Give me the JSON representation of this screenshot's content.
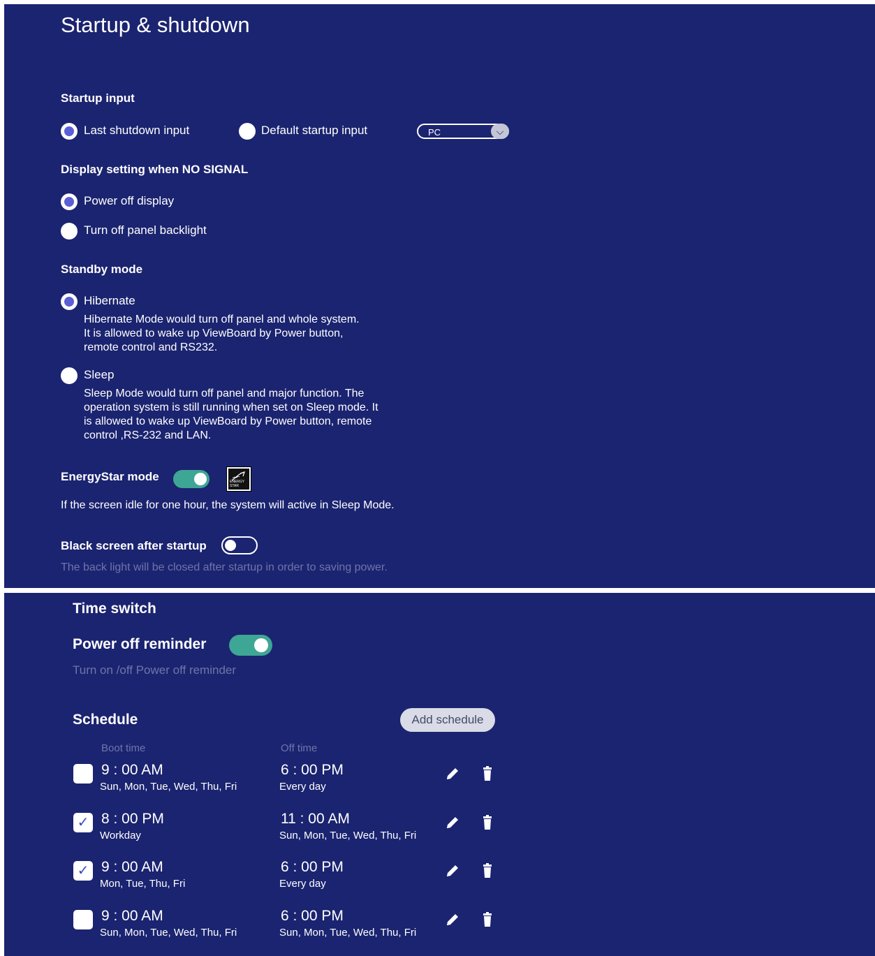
{
  "startup": {
    "title": "Startup & shutdown",
    "startup_input": {
      "heading": "Startup input",
      "options": [
        {
          "label": "Last shutdown input",
          "selected": true
        },
        {
          "label": "Default startup input",
          "selected": false
        }
      ],
      "dropdown_value": "PC"
    },
    "no_signal": {
      "heading": "Display setting when NO SIGNAL",
      "options": [
        {
          "label": "Power off display",
          "selected": true
        },
        {
          "label": "Turn off panel backlight",
          "selected": false
        }
      ]
    },
    "standby": {
      "heading": "Standby mode",
      "options": [
        {
          "label": "Hibernate",
          "selected": true,
          "description": "Hibernate Mode would turn off panel and whole system.\nIt is allowed to wake up ViewBoard by Power button,\nremote control and RS232."
        },
        {
          "label": "Sleep",
          "selected": false,
          "description": "Sleep Mode would turn off panel and major function. The\noperation system is still running when set on Sleep mode. It\nis allowed to wake up ViewBoard by Power button, remote\ncontrol ,RS-232 and LAN."
        }
      ]
    },
    "energystar": {
      "label": "EnergyStar mode",
      "enabled": true,
      "logo_text": "ENERGY STAR",
      "description": "If the screen idle for one hour, the system will active in Sleep Mode."
    },
    "black_screen": {
      "label": "Black screen after startup",
      "enabled": false,
      "description": "The back light will be closed after startup in order to saving power."
    }
  },
  "time_switch": {
    "title": "Time switch",
    "reminder": {
      "label": "Power off reminder",
      "enabled": true,
      "description": "Turn on /off Power off reminder"
    },
    "schedule": {
      "heading": "Schedule",
      "add_button": "Add schedule",
      "col_boot": "Boot time",
      "col_off": "Off time",
      "rows": [
        {
          "checked": false,
          "boot_time": "9 : 00 AM",
          "boot_days": "Sun, Mon, Tue, Wed, Thu, Fri",
          "off_time": "6 : 00 PM",
          "off_days": "Every day"
        },
        {
          "checked": true,
          "boot_time": "8 : 00 PM",
          "boot_days": "Workday",
          "off_time": "11 : 00 AM",
          "off_days": "Sun, Mon, Tue, Wed, Thu, Fri"
        },
        {
          "checked": true,
          "boot_time": "9 : 00 AM",
          "boot_days": "Mon, Tue, Thu, Fri",
          "off_time": "6 : 00 PM",
          "off_days": "Every day"
        },
        {
          "checked": false,
          "boot_time": "9 : 00 AM",
          "boot_days": "Sun, Mon, Tue, Wed, Thu, Fri",
          "off_time": "6 : 00 PM",
          "off_days": "Sun, Mon, Tue, Wed, Thu, Fri"
        }
      ]
    }
  },
  "colors": {
    "panel_bg": "#1b2470",
    "radio_selected": "#5a5fd6",
    "toggle_on": "#3ea694",
    "muted_text": "#6f75a8"
  },
  "icons": {
    "edit": "pencil-icon",
    "delete": "trash-icon",
    "dropdown": "chevron-down-icon"
  }
}
